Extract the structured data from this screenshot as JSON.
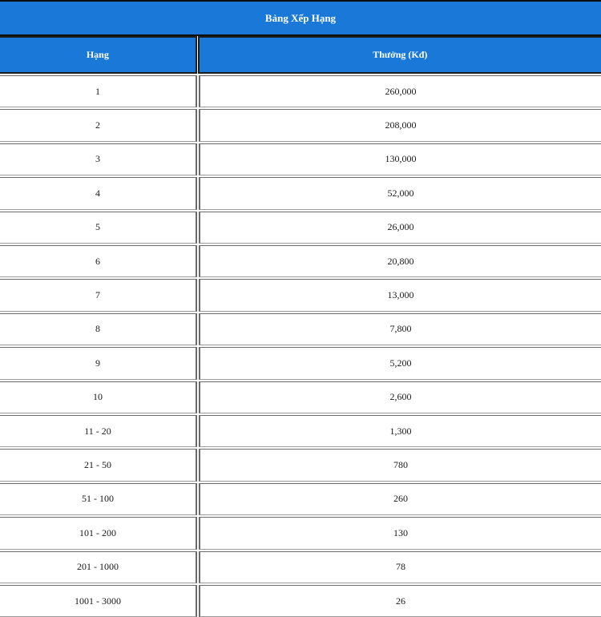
{
  "table": {
    "title": "Bảng Xếp Hạng",
    "headers": {
      "rank": "Hạng",
      "prize": "Thưởng (Kđ)"
    },
    "rows": [
      {
        "rank": "1",
        "prize": "260,000"
      },
      {
        "rank": "2",
        "prize": "208,000"
      },
      {
        "rank": "3",
        "prize": "130,000"
      },
      {
        "rank": "4",
        "prize": "52,000"
      },
      {
        "rank": "5",
        "prize": "26,000"
      },
      {
        "rank": "6",
        "prize": "20,800"
      },
      {
        "rank": "7",
        "prize": "13,000"
      },
      {
        "rank": "8",
        "prize": "7,800"
      },
      {
        "rank": "9",
        "prize": "5,200"
      },
      {
        "rank": "10",
        "prize": "2,600"
      },
      {
        "rank": "11 - 20",
        "prize": "1,300"
      },
      {
        "rank": "21 - 50",
        "prize": "780"
      },
      {
        "rank": "51 - 100",
        "prize": "260"
      },
      {
        "rank": "101 - 200",
        "prize": "130"
      },
      {
        "rank": "201 - 1000",
        "prize": "78"
      },
      {
        "rank": "1001 - 3000",
        "prize": "26"
      }
    ]
  },
  "colors": {
    "header_blue": "#1a79d8",
    "header_text": "#ffffff",
    "body_text": "#1a1a1a"
  }
}
